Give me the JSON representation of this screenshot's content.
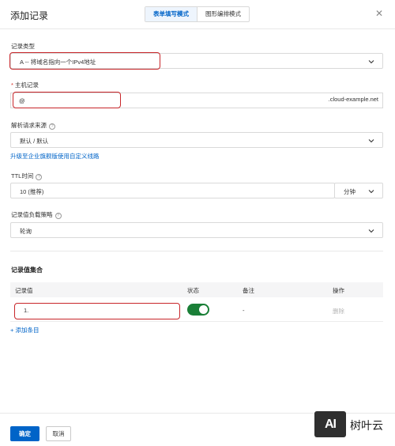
{
  "header": {
    "title": "添加记录",
    "tabs": [
      {
        "label": "表单填写模式",
        "active": true
      },
      {
        "label": "图形编排模式",
        "active": false
      }
    ],
    "close_icon": "close-icon"
  },
  "record_type": {
    "label": "记录类型",
    "value": "A -- 将域名指向一个IPv4地址"
  },
  "host_record": {
    "label": "主机记录",
    "required_mark": "*",
    "value": "@",
    "suffix": ".cloud-example.net"
  },
  "resolve_source": {
    "label": "解析请求来源",
    "value": "默认 / 默认",
    "upgrade_link": "升级至企业旗舰版使用自定义线路"
  },
  "ttl": {
    "label": "TTL时间",
    "value": "10 (推荐)",
    "unit": "分钟"
  },
  "load_balance": {
    "label": "记录值负载策略",
    "value": "轮询"
  },
  "record_set": {
    "title": "记录值集合",
    "columns": [
      "记录值",
      "状态",
      "备注",
      "操作"
    ],
    "rows": [
      {
        "value": "1.",
        "status_enabled": true,
        "remark": "-",
        "action": "删除"
      }
    ],
    "add_link": "+ 添加条目"
  },
  "footer": {
    "confirm": "确定",
    "cancel": "取消"
  },
  "watermark": {
    "logo": "AI",
    "text": "树叶云"
  },
  "colors": {
    "accent": "#0064c8",
    "highlight": "#c8262a",
    "toggle_on": "#1a7f37"
  }
}
